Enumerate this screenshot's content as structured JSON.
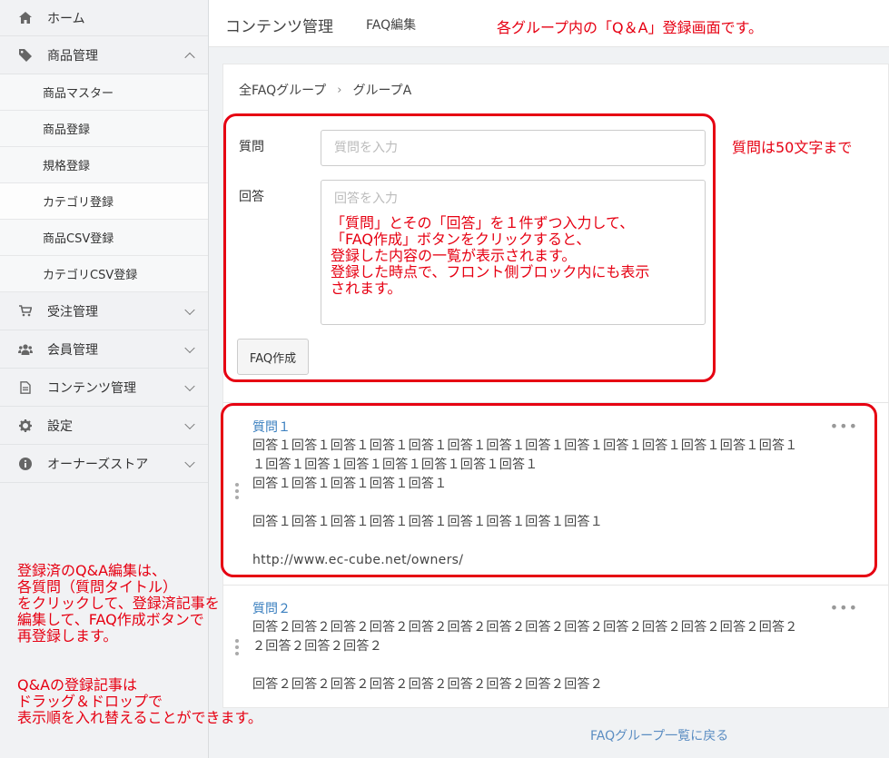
{
  "sidebar": {
    "home": "ホーム",
    "products": {
      "label": "商品管理",
      "items": [
        "商品マスター",
        "商品登録",
        "規格登録",
        "カテゴリ登録",
        "商品CSV登録",
        "カテゴリCSV登録"
      ]
    },
    "orders": "受注管理",
    "members": "会員管理",
    "contents": "コンテンツ管理",
    "settings": "設定",
    "owners_store": "オーナーズストア"
  },
  "header": {
    "title": "コンテンツ管理",
    "subtitle": "FAQ編集"
  },
  "breadcrumb": {
    "root": "全FAQグループ",
    "separator": "›",
    "current": "グループA"
  },
  "form": {
    "question_label": "質問",
    "question_placeholder": "質問を入力",
    "answer_label": "回答",
    "answer_placeholder": "回答を入力",
    "submit_label": "FAQ作成"
  },
  "faqs": [
    {
      "question": "質問１",
      "answer": "回答１回答１回答１回答１回答１回答１回答１回答１回答１回答１回答１回答１回答１回答１\n１回答１回答１回答１回答１回答１回答１回答１\n回答１回答１回答１回答１回答１\n\n回答１回答１回答１回答１回答１回答１回答１回答１回答１\n\nhttp://www.ec-cube.net/owners/"
    },
    {
      "question": "質問２",
      "answer": "回答２回答２回答２回答２回答２回答２回答２回答２回答２回答２回答２回答２回答２回答２\n２回答２回答２回答２\n\n回答２回答２回答２回答２回答２回答２回答２回答２回答２"
    }
  ],
  "more_icon": "•••",
  "back_link": "FAQグループ一覧に戻る",
  "annotations": {
    "top": "各グループ内の「Q＆A」登録画面です。",
    "question_limit": "質問は50文字まで",
    "form_help": "「質問」とその「回答」を１件ずつ入力して、\n「FAQ作成」ボタンをクリックすると、\n登録した内容の一覧が表示されます。\n登録した時点で、フロント側ブロック内にも表示\nされます。",
    "edit_help": "登録済のQ&A編集は、\n各質問（質問タイトル）\nをクリックして、登録済記事を\n編集して、FAQ作成ボタンで\n再登録します。",
    "drag_help": "Q&Aの登録記事は\nドラッグ＆ドロップで\n表示順を入れ替えることができます。",
    "color": "#e60012"
  }
}
